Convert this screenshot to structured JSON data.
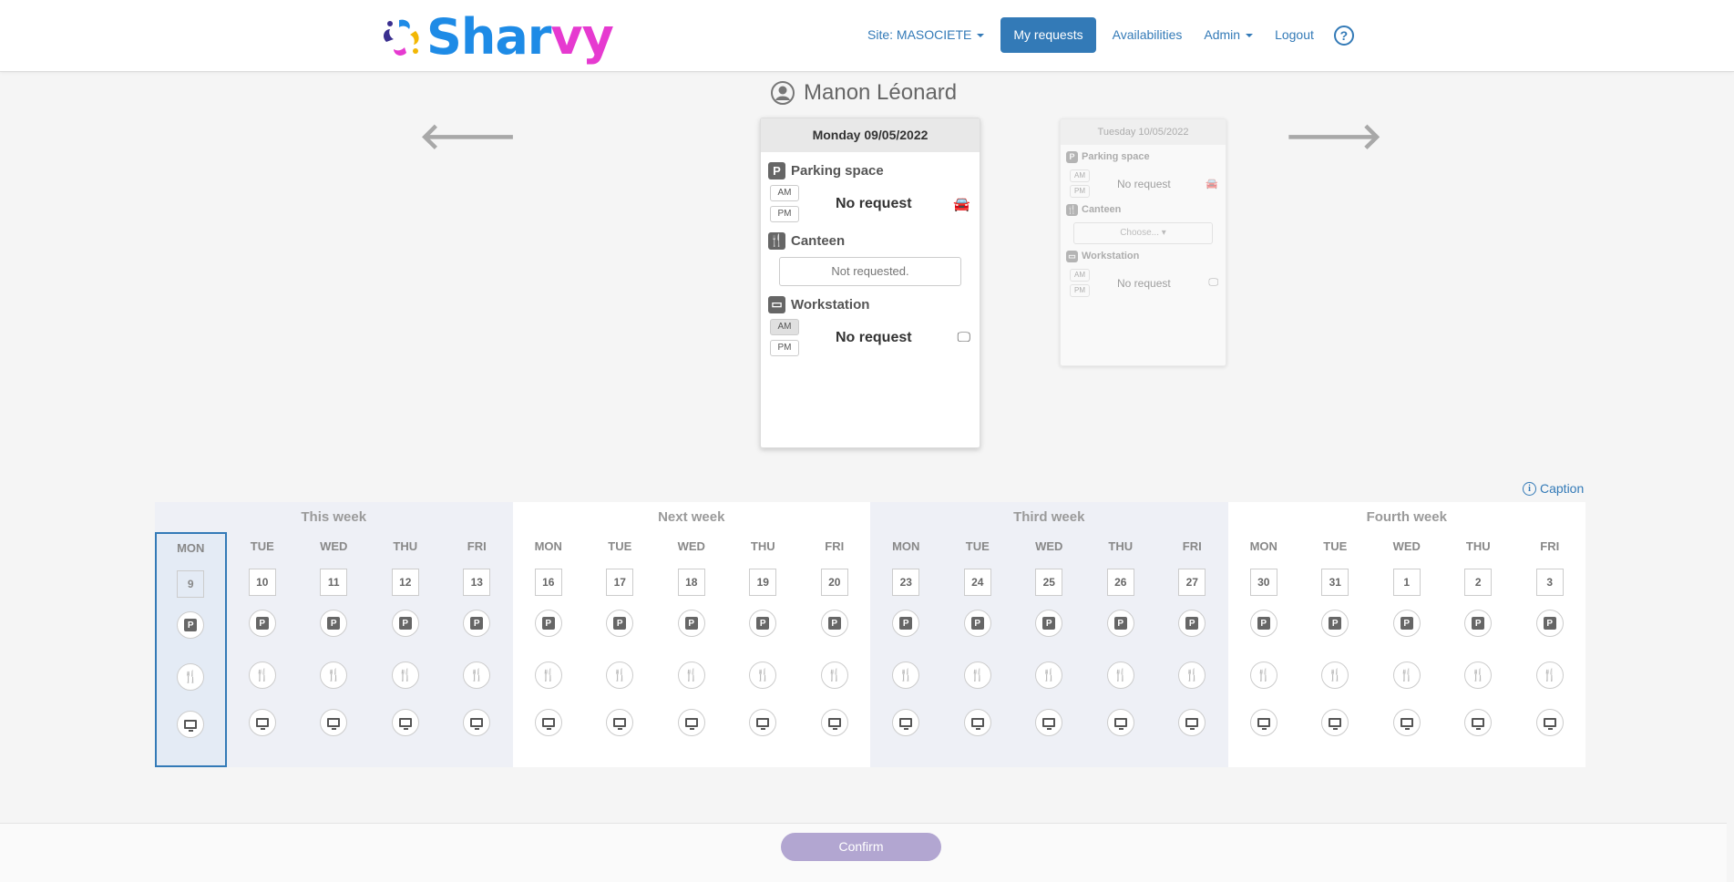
{
  "app": {
    "logo_part1": "Shar",
    "logo_part2": "vy"
  },
  "nav": {
    "site_label": "Site: MASOCIETE",
    "my_requests": "My requests",
    "availabilities": "Availabilities",
    "admin": "Admin",
    "logout": "Logout",
    "help": "?"
  },
  "user": {
    "name": "Manon Léonard"
  },
  "arrows": {
    "prev": "🡐",
    "next": "🡒"
  },
  "day_card_main": {
    "date": "Monday 09/05/2022",
    "parking": {
      "title": "Parking space",
      "am": "AM",
      "pm": "PM",
      "status": "No request"
    },
    "canteen": {
      "title": "Canteen",
      "status": "Not requested."
    },
    "workstation": {
      "title": "Workstation",
      "am": "AM",
      "pm": "PM",
      "status": "No request"
    }
  },
  "day_card_next": {
    "date": "Tuesday 10/05/2022",
    "parking": {
      "title": "Parking space",
      "am": "AM",
      "pm": "PM",
      "status": "No request"
    },
    "canteen": {
      "title": "Canteen",
      "choose": "Choose... ▾"
    },
    "workstation": {
      "title": "Workstation",
      "am": "AM",
      "pm": "PM",
      "status": "No request"
    }
  },
  "caption": "Caption",
  "calendar": {
    "weeks": [
      {
        "title": "This week",
        "days": [
          {
            "name": "MON",
            "num": "9"
          },
          {
            "name": "TUE",
            "num": "10"
          },
          {
            "name": "WED",
            "num": "11"
          },
          {
            "name": "THU",
            "num": "12"
          },
          {
            "name": "FRI",
            "num": "13"
          }
        ]
      },
      {
        "title": "Next week",
        "days": [
          {
            "name": "MON",
            "num": "16"
          },
          {
            "name": "TUE",
            "num": "17"
          },
          {
            "name": "WED",
            "num": "18"
          },
          {
            "name": "THU",
            "num": "19"
          },
          {
            "name": "FRI",
            "num": "20"
          }
        ]
      },
      {
        "title": "Third week",
        "days": [
          {
            "name": "MON",
            "num": "23"
          },
          {
            "name": "TUE",
            "num": "24"
          },
          {
            "name": "WED",
            "num": "25"
          },
          {
            "name": "THU",
            "num": "26"
          },
          {
            "name": "FRI",
            "num": "27"
          }
        ]
      },
      {
        "title": "Fourth week",
        "days": [
          {
            "name": "MON",
            "num": "30"
          },
          {
            "name": "TUE",
            "num": "31"
          },
          {
            "name": "WED",
            "num": "1"
          },
          {
            "name": "THU",
            "num": "2"
          },
          {
            "name": "FRI",
            "num": "3"
          }
        ]
      }
    ]
  },
  "footer": {
    "confirm": "Confirm"
  },
  "colors": {
    "primary": "#337ab7",
    "logo_blue": "#1e8be6",
    "logo_pink": "#e63ad0",
    "confirm_bg": "#b2a6d1"
  }
}
